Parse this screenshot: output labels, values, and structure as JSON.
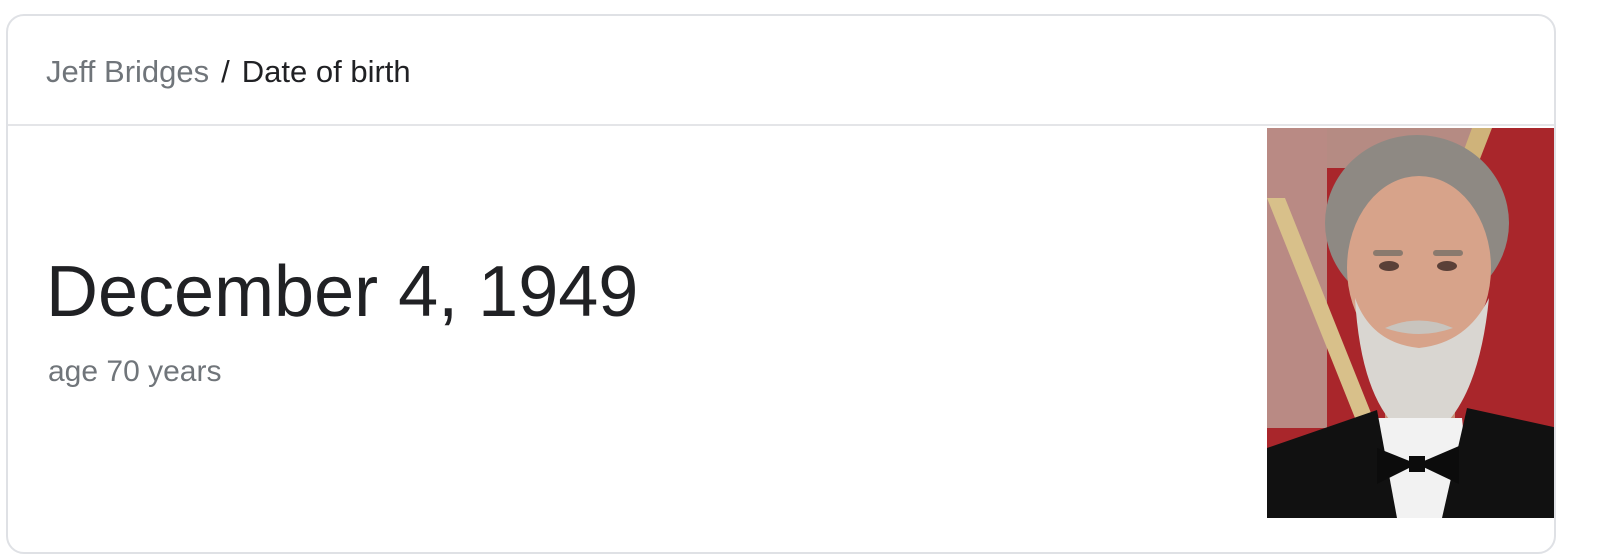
{
  "breadcrumb": {
    "entity": "Jeff Bridges",
    "separator": "/",
    "attribute": "Date of birth"
  },
  "answer": {
    "date": "December 4, 1949",
    "age": "age 70 years"
  },
  "photo": {
    "background_colors": [
      "#a9262b",
      "#b58b83",
      "#d8c08a"
    ],
    "suit_color": "#111111"
  }
}
